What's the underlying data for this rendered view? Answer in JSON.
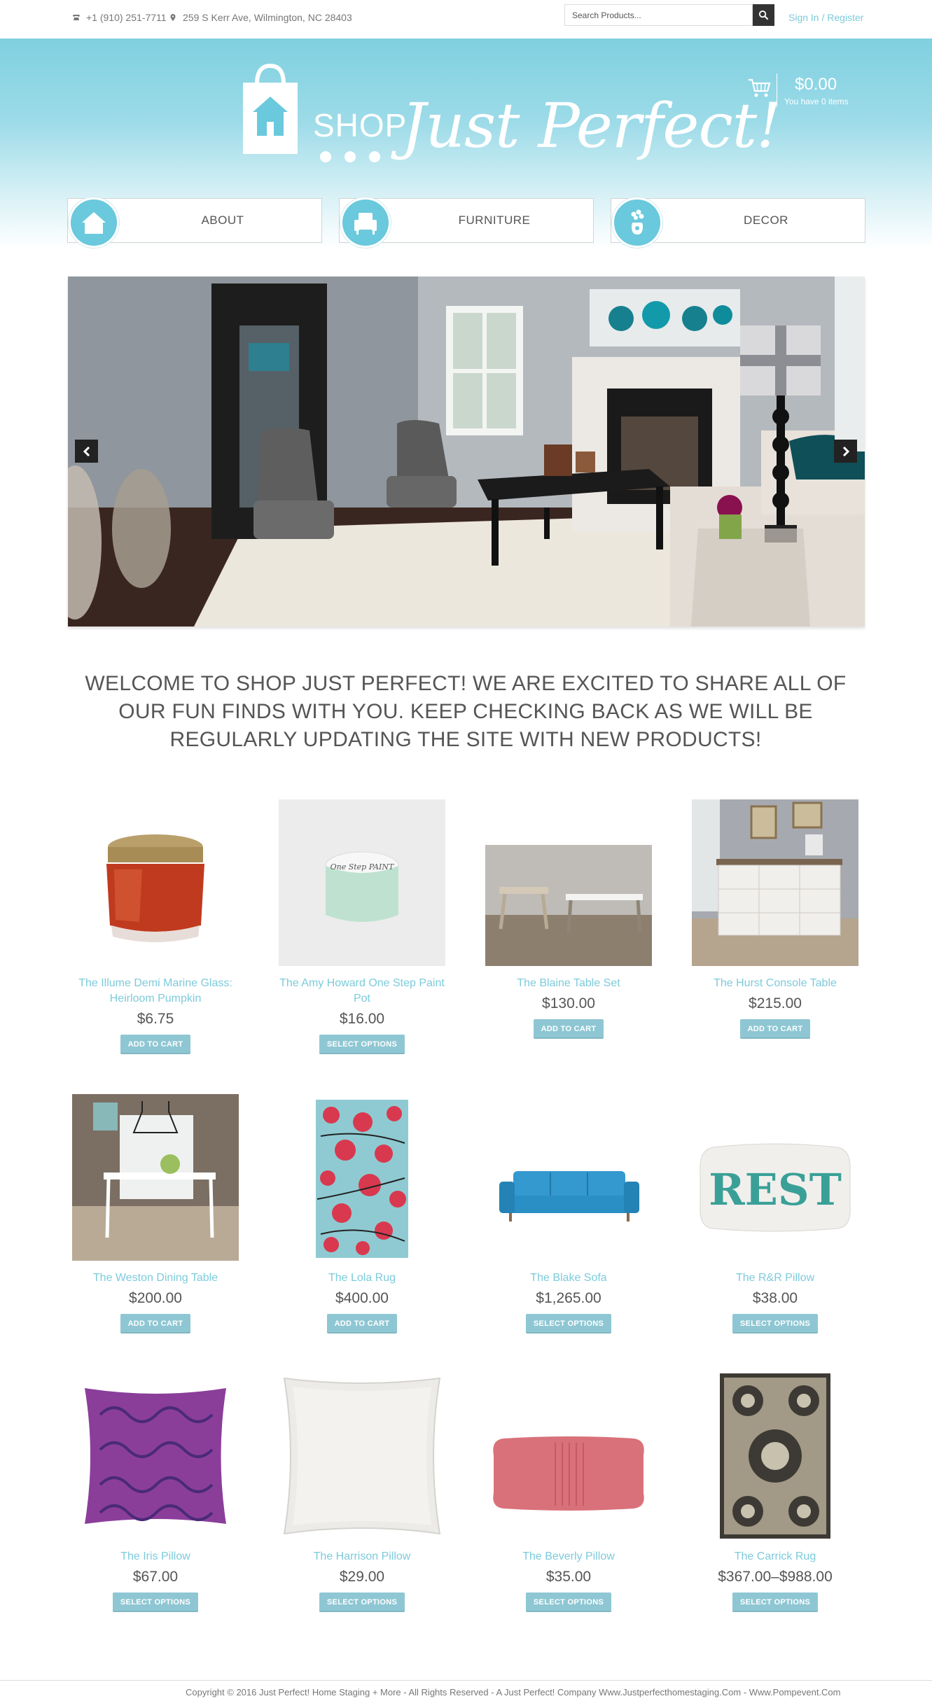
{
  "topbar": {
    "phone": "+1 (910) 251-7711",
    "address": "259 S Kerr Ave, Wilmington, NC 28403",
    "search_placeholder": "Search Products...",
    "sign_in": "Sign In",
    "separator": " / ",
    "register": "Register"
  },
  "logo": {
    "shop": "SHOP",
    "script": "Just Perfect!"
  },
  "cart": {
    "total": "$0.00",
    "count_text": "You have 0 items"
  },
  "nav": [
    {
      "label": "ABOUT",
      "icon": "house-icon"
    },
    {
      "label": "FURNITURE",
      "icon": "armchair-icon"
    },
    {
      "label": "DECOR",
      "icon": "flower-vase-icon"
    }
  ],
  "welcome": "WELCOME TO SHOP JUST PERFECT! WE ARE EXCITED TO SHARE ALL OF OUR FUN FINDS WITH YOU. KEEP CHECKING BACK AS WE WILL BE REGULARLY UPDATING THE SITE WITH NEW PRODUCTS!",
  "products": [
    {
      "name": "The Illume Demi Marine Glass: Heirloom Pumpkin",
      "price": "$6.75",
      "button": "ADD TO CART"
    },
    {
      "name": "The Amy Howard One Step Paint Pot",
      "price": "$16.00",
      "button": "SELECT OPTIONS"
    },
    {
      "name": "The Blaine Table Set",
      "price": "$130.00",
      "button": "ADD TO CART"
    },
    {
      "name": "The Hurst Console Table",
      "price": "$215.00",
      "button": "ADD TO CART"
    },
    {
      "name": "The Weston Dining Table",
      "price": "$200.00",
      "button": "ADD TO CART"
    },
    {
      "name": "The Lola Rug",
      "price": "$400.00",
      "button": "ADD TO CART"
    },
    {
      "name": "The Blake Sofa",
      "price": "$1,265.00",
      "button": "SELECT OPTIONS"
    },
    {
      "name": "The R&R Pillow",
      "price": "$38.00",
      "button": "SELECT OPTIONS"
    },
    {
      "name": "The Iris Pillow",
      "price": "$67.00",
      "button": "SELECT OPTIONS"
    },
    {
      "name": "The Harrison Pillow",
      "price": "$29.00",
      "button": "SELECT OPTIONS"
    },
    {
      "name": "The Beverly Pillow",
      "price": "$35.00",
      "button": "SELECT OPTIONS"
    },
    {
      "name": "The Carrick Rug",
      "price": "$367.00–$988.00",
      "button": "SELECT OPTIONS"
    }
  ],
  "pillow_text": "REST",
  "paint_label": "One Step PAINT",
  "footer": "Copyright © 2016 Just Perfect! Home Staging + More - All Rights Reserved - A Just Perfect! Company Www.Justperfecthomestaging.Com - Www.Pompevent.Com",
  "colors": {
    "accent": "#7ccbdb",
    "button": "#8ec7d3",
    "header_top": "#7fd0e0"
  }
}
